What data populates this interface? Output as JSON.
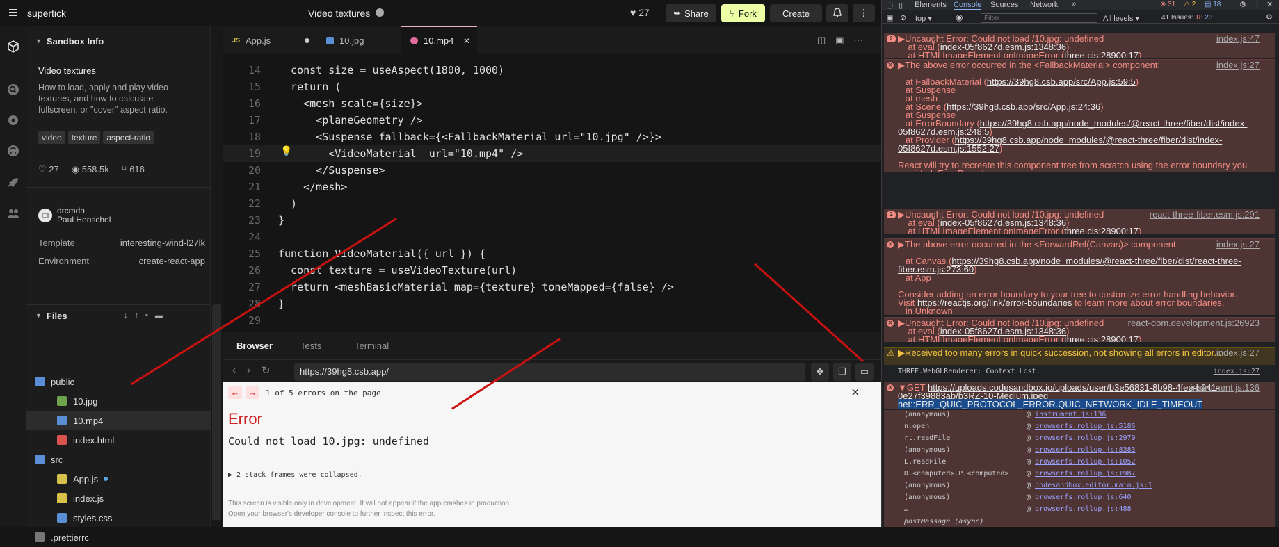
{
  "topbar": {
    "brand": "supertick",
    "title": "Video textures",
    "likes": "27",
    "share": "Share",
    "fork": "Fork",
    "create": "Create"
  },
  "sidebar": {
    "sandbox_info_label": "Sandbox Info",
    "title": "Video textures",
    "description": "How to load, apply and play video textures, and how to calculate fullscreen, or \"cover\" aspect ratio.",
    "tags": [
      "video",
      "texture",
      "aspect-ratio"
    ],
    "stats": {
      "likes": "27",
      "views": "558.5k",
      "forks": "616"
    },
    "author": {
      "handle": "drcmda",
      "name": "Paul Henschel"
    },
    "template_label": "Template",
    "template_value": "interesting-wind-l27lk",
    "environment_label": "Environment",
    "environment_value": "create-react-app",
    "files_label": "Files",
    "files": [
      {
        "name": "public",
        "type": "folder",
        "depth": 0
      },
      {
        "name": "10.jpg",
        "type": "image",
        "depth": 1
      },
      {
        "name": "10.mp4",
        "type": "video",
        "depth": 1,
        "selected": true
      },
      {
        "name": "index.html",
        "type": "html",
        "depth": 1
      },
      {
        "name": "src",
        "type": "folder",
        "depth": 0
      },
      {
        "name": "App.js",
        "type": "js",
        "depth": 1,
        "modified": true
      },
      {
        "name": "index.js",
        "type": "js",
        "depth": 1
      },
      {
        "name": "styles.css",
        "type": "css",
        "depth": 1
      },
      {
        "name": ".prettierrc",
        "type": "config",
        "depth": 0
      }
    ]
  },
  "editor": {
    "tabs": [
      {
        "label": "App.js",
        "modified": true
      },
      {
        "label": "10.jpg"
      },
      {
        "label": "10.mp4",
        "active": true
      }
    ],
    "lines": [
      {
        "num": "14",
        "text": "  const size = useAspect(1800, 1000)"
      },
      {
        "num": "15",
        "text": "  return ("
      },
      {
        "num": "16",
        "text": "    <mesh scale={size}>"
      },
      {
        "num": "17",
        "text": "      <planeGeometry />"
      },
      {
        "num": "18",
        "text": "      <Suspense fallback={<FallbackMaterial url=\"10.jpg\" />}>"
      },
      {
        "num": "19",
        "text": "        <VideoMaterial  url=\"10.mp4\" />"
      },
      {
        "num": "20",
        "text": "      </Suspense>"
      },
      {
        "num": "21",
        "text": "    </mesh>"
      },
      {
        "num": "22",
        "text": "  )"
      },
      {
        "num": "23",
        "text": "}"
      },
      {
        "num": "24",
        "text": ""
      },
      {
        "num": "25",
        "text": "function VideoMaterial({ url }) {"
      },
      {
        "num": "26",
        "text": "  const texture = useVideoTexture(url)"
      },
      {
        "num": "27",
        "text": "  return <meshBasicMaterial map={texture} toneMapped={false} />"
      },
      {
        "num": "28",
        "text": "}"
      },
      {
        "num": "29",
        "text": ""
      }
    ]
  },
  "preview": {
    "tabs": [
      "Browser",
      "Tests",
      "Terminal"
    ],
    "url": "https://39hg8.csb.app/",
    "error_count": "1 of 5 errors on the page",
    "error_title": "Error",
    "error_message": "Could not load 10.jpg: undefined",
    "collapsed": "▶ 2 stack frames were collapsed.",
    "footer1": "This screen is visible only in development. It will not appear if the app crashes in production.",
    "footer2": "Open your browser's developer console to further inspect this error."
  },
  "devtools": {
    "tabs": [
      "Elements",
      "Console",
      "Sources",
      "Network"
    ],
    "active_tab": "Console",
    "badges": {
      "errors": "31",
      "warnings": "2",
      "info": "18"
    },
    "context": "top",
    "filter_placeholder": "Filter",
    "levels": "All levels",
    "issues_label": "41 Issues:",
    "issues_errors": "18",
    "issues_info": "23",
    "stack": [
      {
        "fn": "(anonymous)",
        "loc": "instrument.js:136"
      },
      {
        "fn": "n.open",
        "loc": "browserfs.rollup.js:5186"
      },
      {
        "fn": "rt.readFile",
        "loc": "browserfs.rollup.js:2979"
      },
      {
        "fn": "(anonymous)",
        "loc": "browserfs.rollup.js:8383"
      },
      {
        "fn": "L.readFile",
        "loc": "browserfs.rollup.js:1052"
      },
      {
        "fn": "D.<computed>.P.<computed>",
        "loc": "browserfs.rollup.js:1987"
      },
      {
        "fn": "(anonymous)",
        "loc": "codesandbox.editor.main.js:1"
      },
      {
        "fn": "(anonymous)",
        "loc": "browserfs.rollup.js:640"
      },
      {
        "fn": "…",
        "loc": "browserfs.rollup.js:488"
      }
    ],
    "post_message": "postMessage (async)"
  }
}
